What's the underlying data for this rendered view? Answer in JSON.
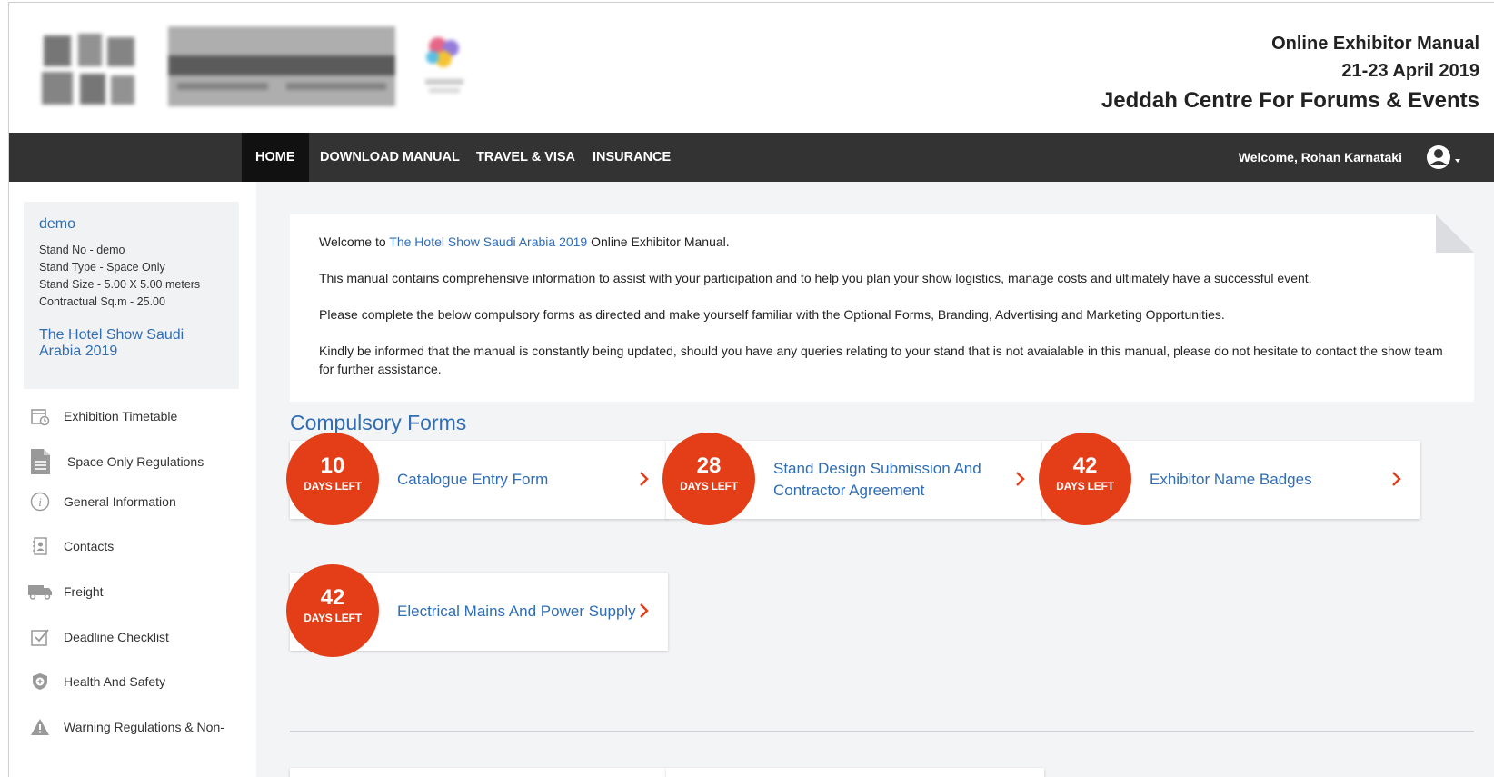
{
  "header": {
    "manual_title": "Online Exhibitor Manual",
    "dates": "21-23 April 2019",
    "venue": "Jeddah Centre For Forums & Events"
  },
  "nav": {
    "items": [
      {
        "label": "HOME",
        "active": true
      },
      {
        "label": "DOWNLOAD MANUAL",
        "active": false
      },
      {
        "label": "TRAVEL & VISA",
        "active": false
      },
      {
        "label": "INSURANCE",
        "active": false
      }
    ],
    "welcome": "Welcome, Rohan Karnataki"
  },
  "profile": {
    "name": "demo",
    "stand_no": "Stand No - demo",
    "stand_type": "Stand Type - Space Only",
    "stand_size": "Stand Size - 5.00 X 5.00 meters",
    "sqm": "Contractual Sq.m - 25.00",
    "event": "The Hotel Show Saudi Arabia 2019"
  },
  "sidebar": {
    "items": [
      {
        "label": "Exhibition Timetable",
        "icon": "calendar-clock-icon"
      },
      {
        "label": "Space Only Regulations",
        "icon": "document-icon"
      },
      {
        "label": "General Information",
        "icon": "info-icon"
      },
      {
        "label": "Contacts",
        "icon": "contact-book-icon"
      },
      {
        "label": "Freight",
        "icon": "truck-icon"
      },
      {
        "label": "Deadline Checklist",
        "icon": "checkbox-icon"
      },
      {
        "label": "Health And Safety",
        "icon": "shield-plus-icon"
      },
      {
        "label": "Warning Regulations & Non-",
        "icon": "warning-icon"
      }
    ]
  },
  "intro": {
    "welcome_prefix": "Welcome to ",
    "event_link": "The Hotel Show Saudi Arabia 2019",
    "welcome_suffix": " Online Exhibitor Manual.",
    "p2": "This manual contains comprehensive information to assist with your participation and to help you plan your show logistics, manage costs and ultimately have a successful event.",
    "p3": "Please complete the below compulsory forms as directed and make yourself familiar with the Optional Forms, Branding, Advertising and Marketing Opportunities.",
    "p4": "Kindly be informed that the manual is constantly being updated, should you have any queries relating to your stand that is not avaialable in this manual, please do not hesitate to contact the show team for further assistance."
  },
  "compulsory": {
    "title": "Compulsory Forms",
    "days_left_label": "DAYS LEFT",
    "forms": [
      {
        "days": "10",
        "title": "Catalogue Entry Form"
      },
      {
        "days": "28",
        "title": "Stand Design Submission And Contractor Agreement"
      },
      {
        "days": "42",
        "title": "Exhibitor Name Badges"
      },
      {
        "days": "42",
        "title": "Electrical Mains And Power Supply"
      }
    ]
  },
  "colors": {
    "accent_blue": "#2f6db5",
    "badge_red": "#e33e18",
    "nav_bg": "#333333"
  }
}
